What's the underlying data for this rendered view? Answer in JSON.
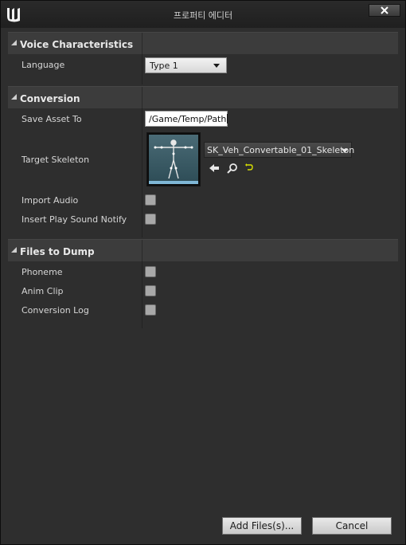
{
  "window": {
    "title": "프로퍼티 에디터"
  },
  "sections": {
    "voice": {
      "title": "Voice Characteristics",
      "language_label": "Language",
      "language_value": "Type 1"
    },
    "conversion": {
      "title": "Conversion",
      "save_asset_label": "Save Asset To",
      "save_asset_value": "/Game/Temp/Path",
      "target_skeleton_label": "Target Skeleton",
      "target_skeleton_value": "SK_Veh_Convertable_01_Skeleton",
      "import_audio_label": "Import Audio",
      "insert_play_sound_label": "Insert Play Sound Notify"
    },
    "files": {
      "title": "Files to Dump",
      "phoneme_label": "Phoneme",
      "anim_clip_label": "Anim Clip",
      "conversion_log_label": "Conversion Log"
    }
  },
  "footer": {
    "add_files_label": "Add Files(s)...",
    "cancel_label": "Cancel"
  },
  "icons": {
    "logo": "unreal-logo-icon",
    "close": "close-icon",
    "browse": "use-selected-arrow-icon",
    "find": "search-icon",
    "reset": "reset-to-default-icon"
  },
  "colors": {
    "window_bg": "#2e2e2e",
    "header_bg": "#3c3c3c",
    "checkbox": "#a8a8a8"
  }
}
